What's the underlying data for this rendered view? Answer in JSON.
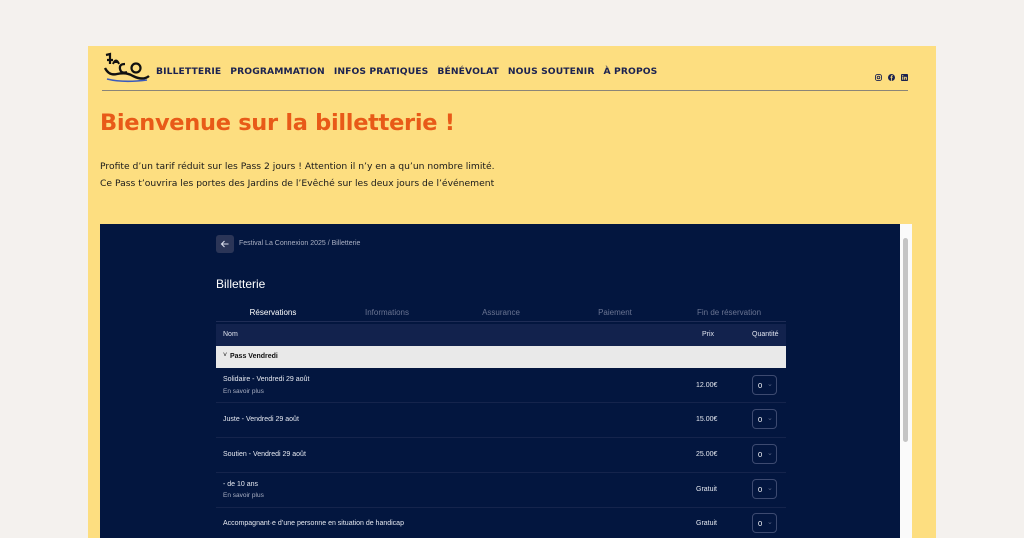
{
  "nav": {
    "items": [
      "BILLETTERIE",
      "PROGRAMMATION",
      "INFOS PRATIQUES",
      "BÉNÉVOLAT",
      "NOUS SOUTENIR",
      "À PROPOS"
    ],
    "social": [
      "instagram-icon",
      "facebook-icon",
      "linkedin-icon"
    ]
  },
  "page": {
    "title": "Bienvenue sur la billetterie !",
    "intro_1": "Profite d’un tarif réduit sur les Pass 2 jours ! Attention il n’y en a qu’un nombre limité.",
    "intro_2": "Ce Pass t’ouvrira les portes des Jardins de l’Evêché sur les deux jours de l’événement",
    "accent_color": "#e85a18",
    "background_color": "#fdde80"
  },
  "widget": {
    "breadcrumb": "Festival La Connexion 2025 / Billetterie",
    "title": "Billetterie",
    "steps": [
      "Réservations",
      "Informations",
      "Assurance",
      "Paiement",
      "Fin de réservation"
    ],
    "active_step": "Réservations",
    "columns": {
      "name": "Nom",
      "price": "Prix",
      "qty": "Quantité"
    },
    "group": {
      "chevron": "˅",
      "label": "Pass Vendredi"
    },
    "rows": [
      {
        "name": "Solidaire - Vendredi 29 août",
        "more": "En savoir plus",
        "price": "12.00€",
        "qty": "0"
      },
      {
        "name": "Juste - Vendredi 29 août",
        "more": "",
        "price": "15.00€",
        "qty": "0"
      },
      {
        "name": "Soutien - Vendredi 29 août",
        "more": "",
        "price": "25.00€",
        "qty": "0"
      },
      {
        "name": "- de 10 ans",
        "more": "En savoir plus",
        "price": "Gratuit",
        "qty": "0"
      },
      {
        "name": "Accompagnant·e d’une personne en situation de handicap",
        "more": "",
        "price": "Gratuit",
        "qty": "0"
      }
    ],
    "background_color": "#03163f"
  }
}
